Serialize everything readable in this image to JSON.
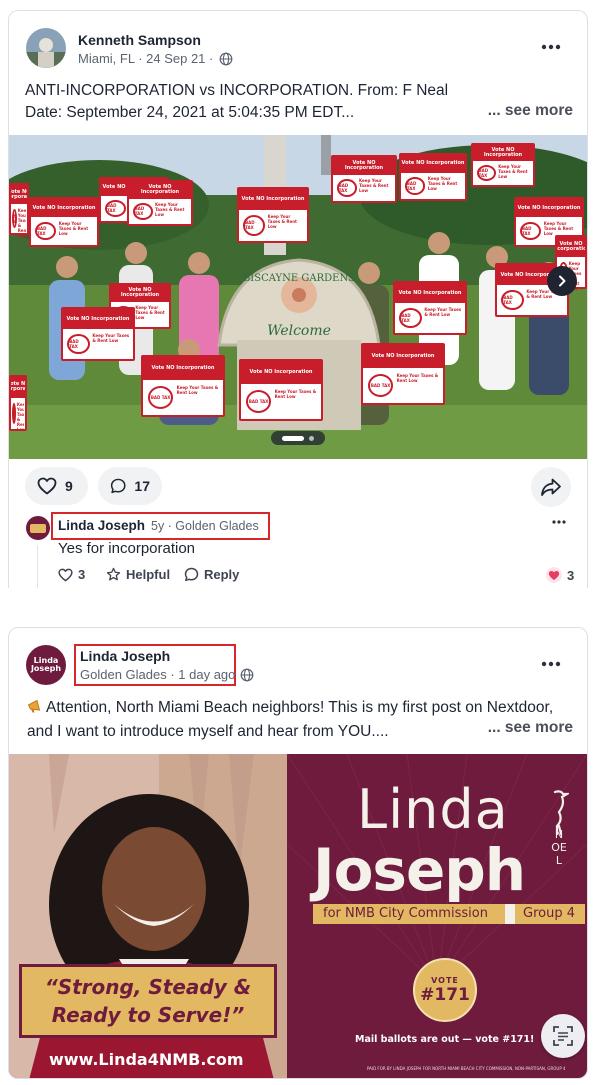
{
  "post1": {
    "author": "Kenneth Sampson",
    "meta": "Miami, FL · 24 Sep 21 ·",
    "text_line1": "ANTI-INCORPORATION vs INCORPORATION. From: F Neal",
    "text_line2": "Date: September 24, 2021 at 5:04:35 PM EDT...",
    "see_more": "... see more",
    "photo": {
      "sign_top_text": "Vote NO Incorporation",
      "sign_bottom_text": "Keep Your Taxes & Rent Low",
      "sign_badge_text": "BAD TAX",
      "monument_title": "BISCAYNE GARDENS",
      "monument_subtitle": "Welcome"
    },
    "likes": "9",
    "comments": "17"
  },
  "comment": {
    "author": "Linda Joseph",
    "meta": "5y · Golden Glades",
    "text": "Yes for incorporation",
    "likes": "3",
    "helpful_label": "Helpful",
    "reply_label": "Reply",
    "reaction_count": "3"
  },
  "post2": {
    "author": "Linda Joseph",
    "meta": "Golden Glades · 1 day ago",
    "text_line1": "Attention, North Miami Beach neighbors! This is my first post on Nextdoor,",
    "text_line2": "and I want to introduce myself and hear from YOU....",
    "see_more": "... see more",
    "avatar_text": "Linda Joseph",
    "flyer": {
      "first_name": "Linda",
      "last_name": "Joseph",
      "middle": "NOEL",
      "office_left": "for NMB City Commission",
      "office_right": "Group 4",
      "slogan_line1": "“Strong, Steady &",
      "slogan_line2": "Ready to Serve!”",
      "vote_label": "VOTE",
      "vote_number": "#171",
      "mail_note": "Mail ballots are out — vote #171!",
      "website": "www.Linda4NMB.com",
      "fine_print": "PAID FOR BY LINDA JOSEPH FOR NORTH MIAMI BEACH CITY COMMISSION, NON-PARTISAN, GROUP 4"
    }
  },
  "colors": {
    "maroon": "#6e1b3d",
    "gold": "#e2b862",
    "sign_red": "#c81e2b",
    "highlight_red": "#d9262b"
  }
}
